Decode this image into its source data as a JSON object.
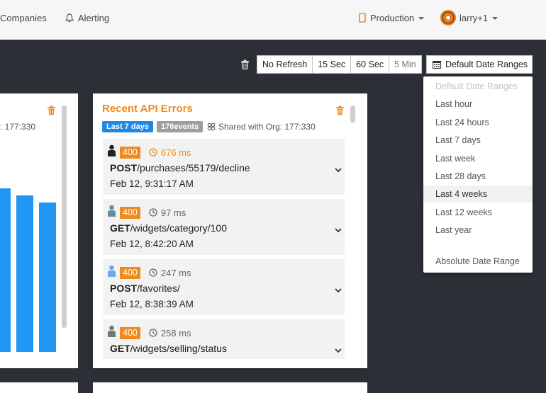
{
  "nav": {
    "companies": "Companies",
    "alerting": "Alerting",
    "environment": "Production",
    "user": "larry+1"
  },
  "toolbar": {
    "refresh_options": [
      "No Refresh",
      "15 Sec",
      "60 Sec",
      "5 Min"
    ],
    "active_refresh": "5 Min",
    "date_ranges_label": "Default Date Ranges"
  },
  "date_dropdown": {
    "header": "Default Date Ranges",
    "items": [
      "Last hour",
      "Last 24 hours",
      "Last 7 days",
      "Last week",
      "Last 28 days",
      "Last 4 weeks",
      "Last 12 weeks",
      "Last year"
    ],
    "selected": "Last 4 weeks",
    "absolute": "Absolute Date Range"
  },
  "left_card": {
    "org_partial": ": 177:330",
    "bar_values": [
      0.68,
      0.65,
      0.6
    ]
  },
  "card": {
    "title": "Recent API Errors",
    "range_tag": "Last 7 days",
    "events_tag": "176events",
    "shared": "Shared with Org: 177:330",
    "errors": [
      {
        "status": "400",
        "duration": "676 ms",
        "method": "POST",
        "path": "/purchases/55179/decline",
        "time": "Feb 12, 9:31:17 AM",
        "user_color": "#222222",
        "dur_color": "#ef8a1f"
      },
      {
        "status": "400",
        "duration": "97 ms",
        "method": "GET",
        "path": "/widgets/category/100",
        "time": "Feb 12, 8:42:20 AM",
        "user_color": "#5f8fa0",
        "dur_color": "#666666"
      },
      {
        "status": "400",
        "duration": "247 ms",
        "method": "POST",
        "path": "/favorites/",
        "time": "Feb 12, 8:38:39 AM",
        "user_color": "#6fa7e0",
        "dur_color": "#666666"
      },
      {
        "status": "400",
        "duration": "258 ms",
        "method": "GET",
        "path": "/widgets/selling/status",
        "time": "",
        "user_color": "#6e7e6c",
        "dur_color": "#666666"
      }
    ]
  },
  "colors": {
    "accent": "#ef8a1f",
    "blue": "#1e88e5",
    "bg": "#2c3036"
  },
  "icons": [
    "bell-icon",
    "phone-icon",
    "trash-icon",
    "calendar-icon",
    "clock-icon",
    "user-icon",
    "share-icon",
    "chevron-down-icon"
  ]
}
